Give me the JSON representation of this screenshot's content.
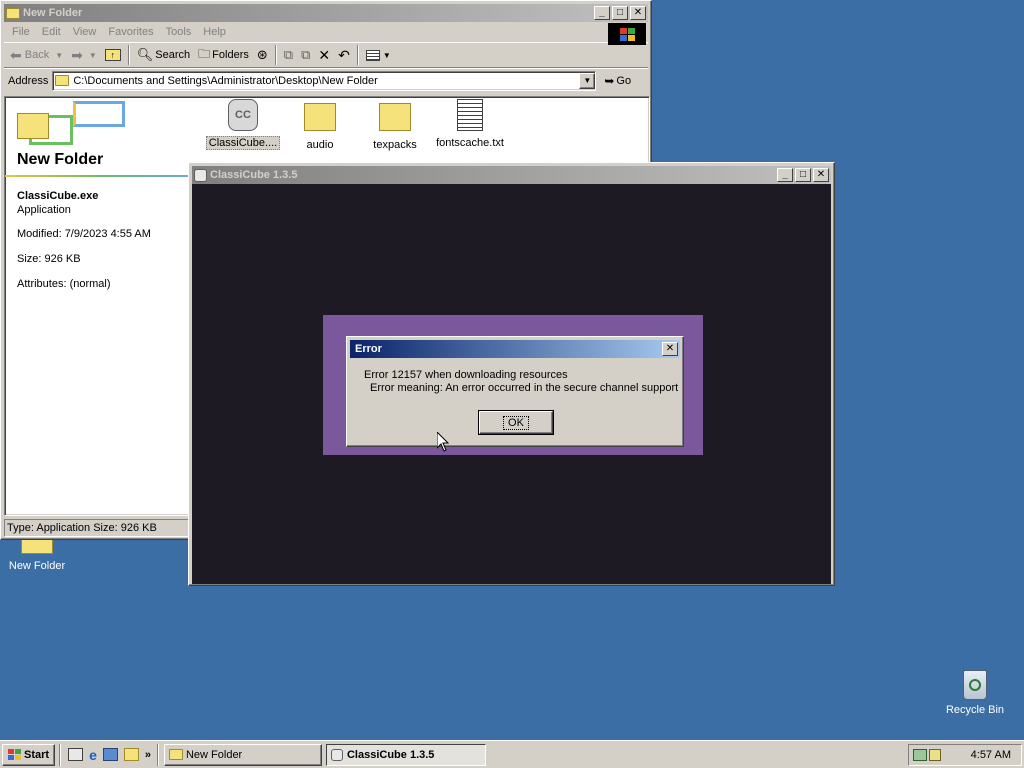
{
  "explorer": {
    "title": "New Folder",
    "menu": [
      "File",
      "Edit",
      "View",
      "Favorites",
      "Tools",
      "Help"
    ],
    "toolbar": {
      "back": "Back",
      "search": "Search",
      "folders": "Folders"
    },
    "address_label": "Address",
    "address_value": "C:\\Documents and Settings\\Administrator\\Desktop\\New Folder",
    "go_label": "Go",
    "folder_heading": "New Folder",
    "details": {
      "name": "ClassiCube.exe",
      "type": "Application",
      "modified": "Modified: 7/9/2023 4:55 AM",
      "size": "Size: 926 KB",
      "attributes": "Attributes: (normal)"
    },
    "files": [
      {
        "label": "ClassiCube....",
        "kind": "exe",
        "selected": true
      },
      {
        "label": "audio",
        "kind": "folder"
      },
      {
        "label": "texpacks",
        "kind": "folder"
      },
      {
        "label": "fontscache.txt",
        "kind": "text"
      }
    ],
    "status": "Type: Application Size: 926 KB"
  },
  "game": {
    "title": "ClassiCube 1.3.5",
    "bg_color": "#1e1a23",
    "overlay_color": "#7b579b"
  },
  "dialog": {
    "title": "Error",
    "line1": "Error 12157 when downloading resources",
    "line2": "Error meaning: An error occurred in the secure channel support",
    "ok": "OK"
  },
  "desktop": {
    "new_folder_label": "New Folder",
    "recycle_label": "Recycle Bin",
    "bg_color": "#3a6ea5"
  },
  "taskbar": {
    "start": "Start",
    "tasks": [
      {
        "label": "New Folder"
      },
      {
        "label": "ClassiCube 1.3.5",
        "active": true
      }
    ],
    "clock": "4:57 AM"
  }
}
